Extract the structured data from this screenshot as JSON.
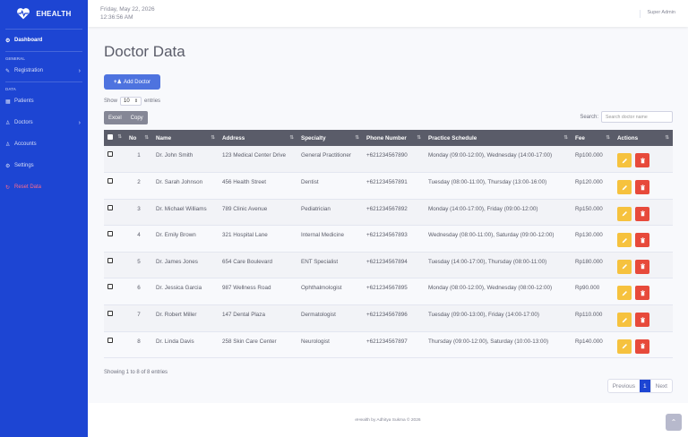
{
  "brand": {
    "name": "EHEALTH"
  },
  "sidebar": {
    "dashboard": "Dashboard",
    "section_general": "GENERAL",
    "registration": "Registration",
    "section_data": "DATA",
    "patients": "Patients",
    "doctors": "Doctors",
    "accounts": "Accounts",
    "settings": "Settings",
    "reset": "Reset Data"
  },
  "topbar": {
    "date": "Friday, May 22, 2026",
    "time": "12:36:56 AM",
    "user": "Super Admin"
  },
  "page": {
    "title": "Doctor Data",
    "add_button": "Add Doctor"
  },
  "length": {
    "show": "Show",
    "value": "10",
    "entries": "entries"
  },
  "export": {
    "excel": "Excel",
    "copy": "Copy"
  },
  "search": {
    "label": "Search:",
    "placeholder": "Search doctor name"
  },
  "table": {
    "headers": [
      "No",
      "Name",
      "Address",
      "Specialty",
      "Phone Number",
      "Practice Schedule",
      "Fee",
      "Actions"
    ],
    "rows": [
      {
        "no": "1",
        "name": "Dr. John Smith",
        "address": "123 Medical Center Drive",
        "specialty": "General Practitioner",
        "phone": "+621234567890",
        "schedule": "Monday (09:00-12:00), Wednesday (14:00-17:00)",
        "fee": "Rp100.000"
      },
      {
        "no": "2",
        "name": "Dr. Sarah Johnson",
        "address": "456 Health Street",
        "specialty": "Dentist",
        "phone": "+621234567891",
        "schedule": "Tuesday (08:00-11:00), Thursday (13:00-16:00)",
        "fee": "Rp120.000"
      },
      {
        "no": "3",
        "name": "Dr. Michael Williams",
        "address": "789 Clinic Avenue",
        "specialty": "Pediatrician",
        "phone": "+621234567892",
        "schedule": "Monday (14:00-17:00), Friday (09:00-12:00)",
        "fee": "Rp150.000"
      },
      {
        "no": "4",
        "name": "Dr. Emily Brown",
        "address": "321 Hospital Lane",
        "specialty": "Internal Medicine",
        "phone": "+621234567893",
        "schedule": "Wednesday (08:00-11:00), Saturday (09:00-12:00)",
        "fee": "Rp130.000"
      },
      {
        "no": "5",
        "name": "Dr. James Jones",
        "address": "654 Care Boulevard",
        "specialty": "ENT Specialist",
        "phone": "+621234567894",
        "schedule": "Tuesday (14:00-17:00), Thursday (08:00-11:00)",
        "fee": "Rp180.000"
      },
      {
        "no": "6",
        "name": "Dr. Jessica Garcia",
        "address": "987 Wellness Road",
        "specialty": "Ophthalmologist",
        "phone": "+621234567895",
        "schedule": "Monday (08:00-12:00), Wednesday (08:00-12:00)",
        "fee": "Rp90.000"
      },
      {
        "no": "7",
        "name": "Dr. Robert Miller",
        "address": "147 Dental Plaza",
        "specialty": "Dermatologist",
        "phone": "+621234567896",
        "schedule": "Tuesday (09:00-13:00), Friday (14:00-17:00)",
        "fee": "Rp110.000"
      },
      {
        "no": "8",
        "name": "Dr. Linda Davis",
        "address": "258 Skin Care Center",
        "specialty": "Neurologist",
        "phone": "+621234567897",
        "schedule": "Thursday (09:00-12:00), Saturday (10:00-13:00)",
        "fee": "Rp140.000"
      }
    ]
  },
  "info": "Showing 1 to 8 of 8 entries",
  "pagination": {
    "previous": "Previous",
    "page": "1",
    "next": "Next"
  },
  "footer": "eHealth by Adhitya Sukma © 2026",
  "colors": {
    "sidebar": "#1d45d3",
    "primary": "#4e73df",
    "edit": "#f6c23e",
    "delete": "#e74a3b",
    "table_header": "#5a5c69"
  }
}
